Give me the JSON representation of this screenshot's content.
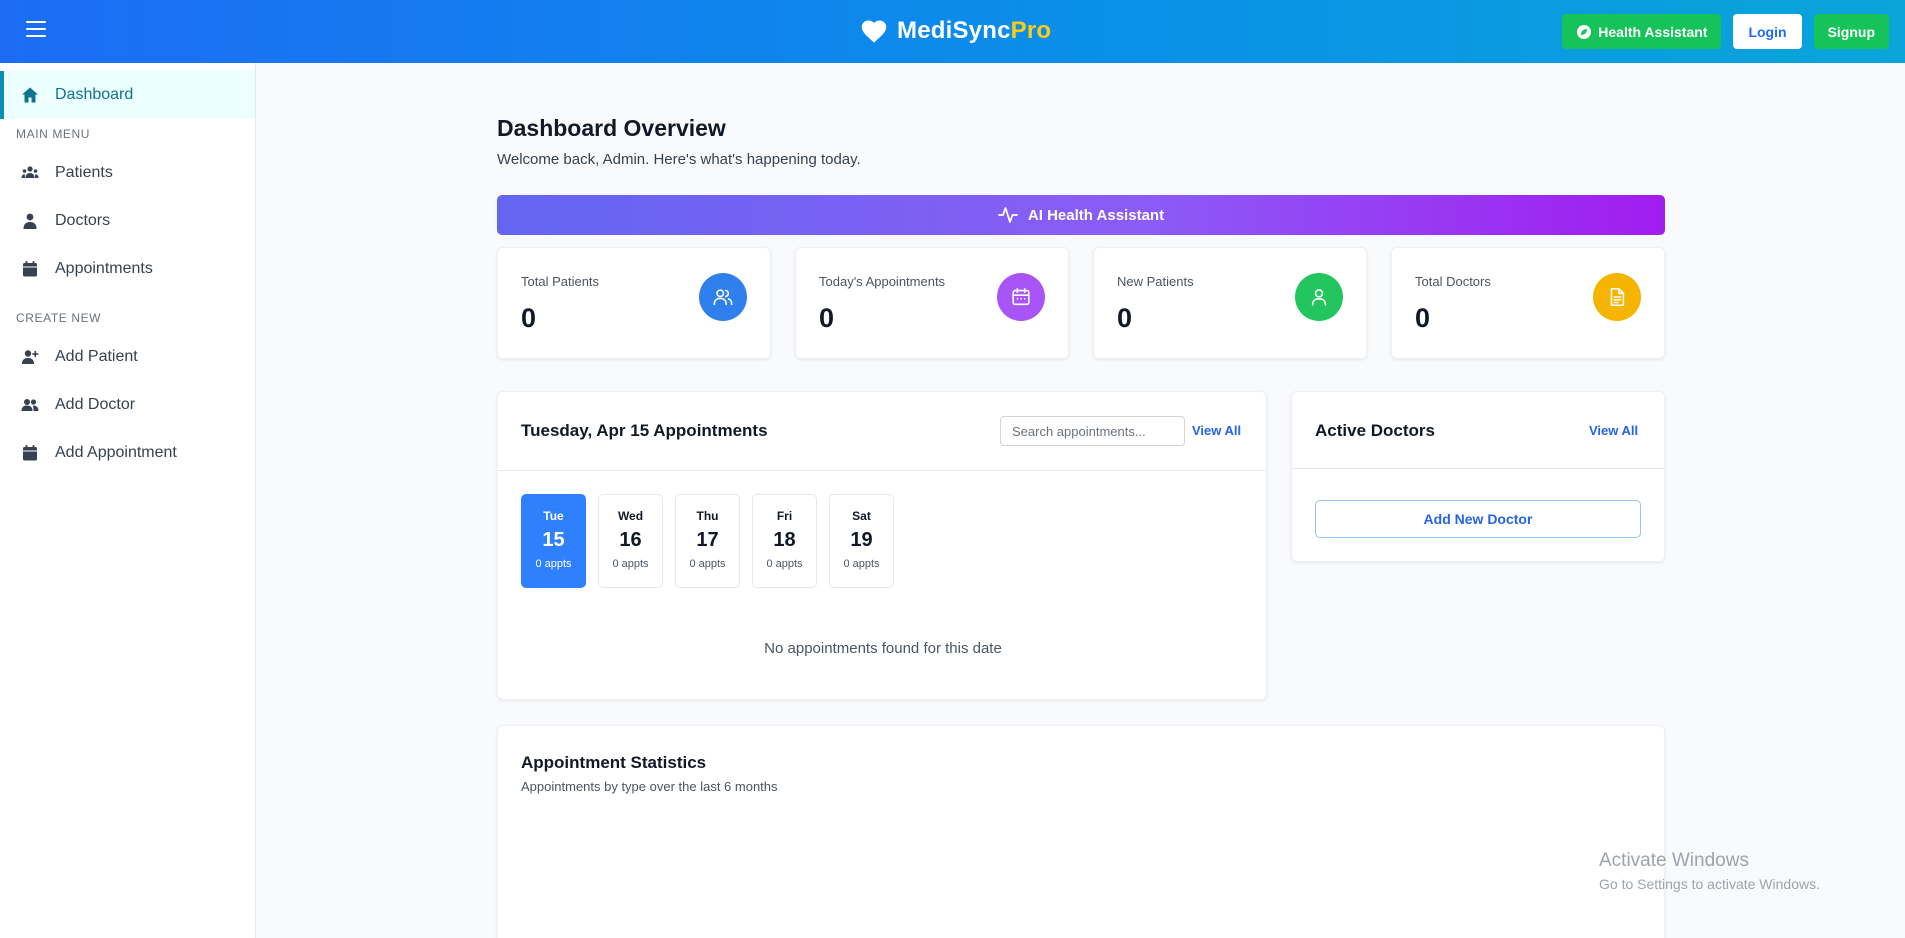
{
  "header": {
    "brand_main": "MediSync",
    "brand_accent": "Pro",
    "health_assistant_label": "Health Assistant",
    "login_label": "Login",
    "signup_label": "Signup"
  },
  "sidebar": {
    "dashboard": "Dashboard",
    "main_menu_title": "MAIN MENU",
    "main_menu": [
      "Patients",
      "Doctors",
      "Appointments"
    ],
    "create_new_title": "CREATE NEW",
    "create_new": [
      "Add Patient",
      "Add Doctor",
      "Add Appointment"
    ]
  },
  "main": {
    "title": "Dashboard Overview",
    "subtitle": "Welcome back, Admin. Here's what's happening today.",
    "ai_button_label": "AI Health Assistant"
  },
  "stats": [
    {
      "label": "Total Patients",
      "value": "0",
      "color": "#2f80ed"
    },
    {
      "label": "Today's Appointments",
      "value": "0",
      "color": "#a855f7"
    },
    {
      "label": "New Patients",
      "value": "0",
      "color": "#22c55e"
    },
    {
      "label": "Total Doctors",
      "value": "0",
      "color": "#f5b400"
    }
  ],
  "appointments": {
    "title": "Tuesday, Apr 15 Appointments",
    "search_placeholder": "Search appointments...",
    "view_all_label": "View All",
    "days": [
      {
        "name": "Tue",
        "num": "15",
        "count": "0 appts",
        "active": true
      },
      {
        "name": "Wed",
        "num": "16",
        "count": "0 appts",
        "active": false
      },
      {
        "name": "Thu",
        "num": "17",
        "count": "0 appts",
        "active": false
      },
      {
        "name": "Fri",
        "num": "18",
        "count": "0 appts",
        "active": false
      },
      {
        "name": "Sat",
        "num": "19",
        "count": "0 appts",
        "active": false
      }
    ],
    "empty_message": "No appointments found for this date"
  },
  "doctors": {
    "title": "Active Doctors",
    "view_all_label": "View All",
    "add_button_label": "Add New Doctor"
  },
  "statistics": {
    "title": "Appointment Statistics",
    "subtitle": "Appointments by type over the last 6 months"
  },
  "watermark": {
    "line1": "Activate Windows",
    "line2": "Go to Settings to activate Windows."
  }
}
